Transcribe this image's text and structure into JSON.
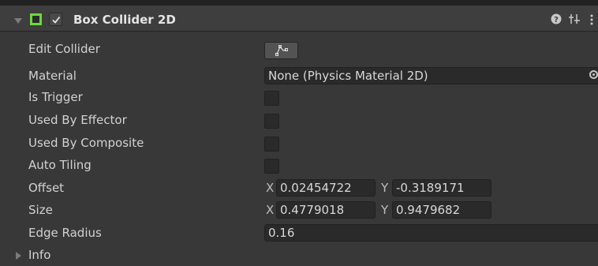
{
  "component": {
    "title": "Box Collider 2D",
    "icon": "box-collider-2d-icon",
    "enabled": true,
    "header_icons": [
      "help-icon",
      "presets-icon",
      "context-menu-icon"
    ]
  },
  "fields": {
    "edit_collider": {
      "label": "Edit Collider",
      "button_icon": "edit-collider-icon"
    },
    "material": {
      "label": "Material",
      "value": "None (Physics Material 2D)",
      "picker_icon": "object-picker-icon"
    },
    "is_trigger": {
      "label": "Is Trigger",
      "checked": false
    },
    "used_by_effector": {
      "label": "Used By Effector",
      "checked": false
    },
    "used_by_composite": {
      "label": "Used By Composite",
      "checked": false
    },
    "auto_tiling": {
      "label": "Auto Tiling",
      "checked": false
    },
    "offset": {
      "label": "Offset",
      "x_label": "X",
      "x": "0.02454722",
      "y_label": "Y",
      "y": "-0.3189171"
    },
    "size": {
      "label": "Size",
      "x_label": "X",
      "x": "0.4779018",
      "y_label": "Y",
      "y": "0.9479682"
    },
    "edge_radius": {
      "label": "Edge Radius",
      "value": "0.16"
    },
    "info": {
      "label": "Info",
      "expanded": false
    }
  },
  "colors": {
    "background": "#383838",
    "header": "#3e3e3e",
    "field": "#2a2a2a",
    "collider_green": "#6cd93a",
    "text": "#d2d2d2"
  }
}
